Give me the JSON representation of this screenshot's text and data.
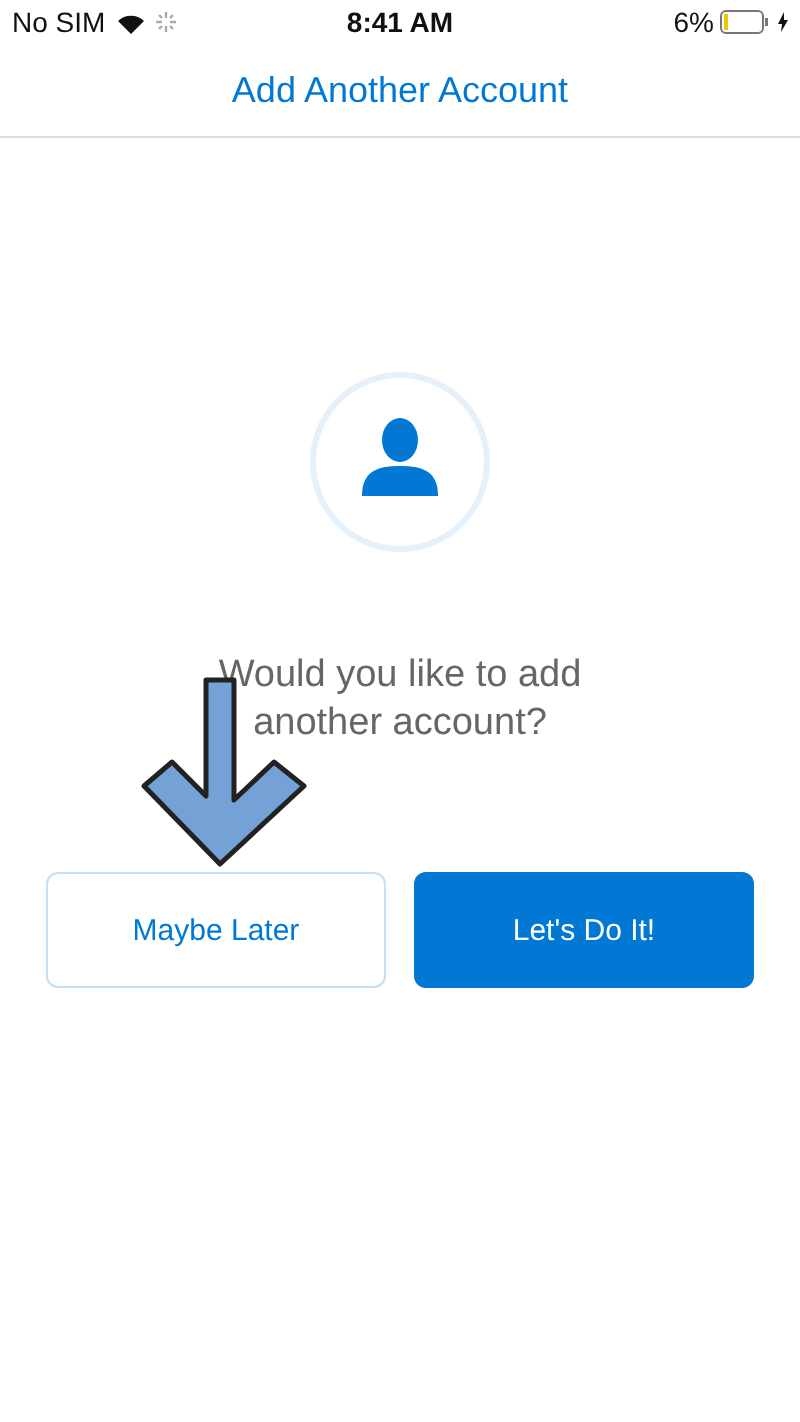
{
  "status_bar": {
    "carrier": "No SIM",
    "time": "8:41 AM",
    "battery": "6%"
  },
  "header": {
    "title": "Add Another Account"
  },
  "prompt": "Would you like to add another account?",
  "buttons": [
    {
      "label": "Maybe Later",
      "kind": "secondary"
    },
    {
      "label": "Let's Do It!",
      "kind": "primary"
    }
  ]
}
